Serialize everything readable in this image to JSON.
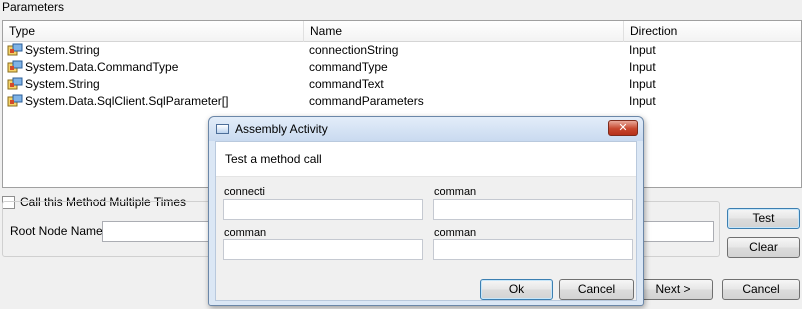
{
  "parameters": {
    "section_label": "Parameters",
    "columns": [
      "Type",
      "Name",
      "Direction"
    ],
    "rows": [
      {
        "type": "System.String",
        "name": "connectionString",
        "direction": "Input"
      },
      {
        "type": "System.Data.CommandType",
        "name": "commandType",
        "direction": "Input"
      },
      {
        "type": "System.String",
        "name": "commandText",
        "direction": "Input"
      },
      {
        "type": "System.Data.SqlClient.SqlParameter[]",
        "name": "commandParameters",
        "direction": "Input"
      }
    ]
  },
  "options": {
    "call_multiple_label": "Call this Method Multiple Times",
    "call_multiple_checked": false,
    "root_node_label": "Root Node Name:",
    "root_node_value": ""
  },
  "buttons": {
    "test": "Test",
    "clear": "Clear",
    "next": "Next >",
    "cancel": "Cancel"
  },
  "dialog": {
    "title": "Assembly Activity",
    "close_glyph": "✕",
    "subtitle": "Test a method call",
    "fields": [
      {
        "label": "connecti",
        "value": ""
      },
      {
        "label": "comman",
        "value": ""
      },
      {
        "label": "comman",
        "value": ""
      },
      {
        "label": "comman",
        "value": ""
      }
    ],
    "ok": "Ok",
    "cancel": "Cancel"
  },
  "icons": {
    "row_type_icon": "parameter-type-icon",
    "dialog_icon": "window-icon"
  },
  "colors": {
    "dialog_frame": "#dbe7f5",
    "close_button": "#c7472e",
    "default_button_border": "#3c7fb1"
  }
}
